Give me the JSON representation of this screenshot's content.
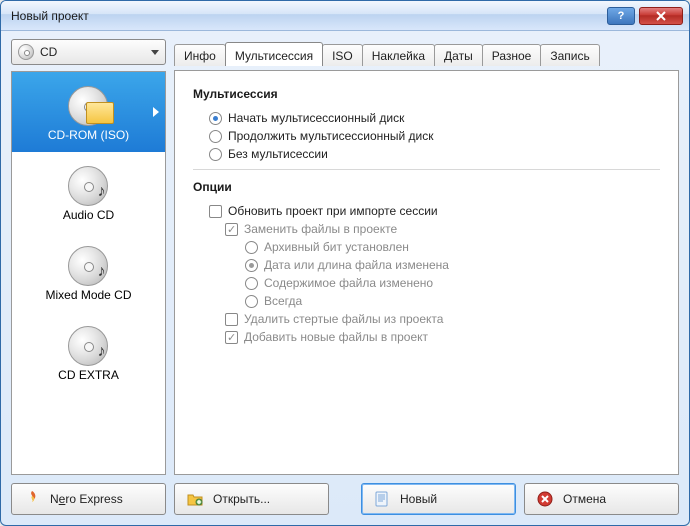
{
  "window": {
    "title": "Новый проект"
  },
  "combo": {
    "label": "CD"
  },
  "tabs": {
    "info": "Инфо",
    "multi": "Мультисессия",
    "iso": "ISO",
    "label": "Наклейка",
    "dates": "Даты",
    "misc": "Разное",
    "burn": "Запись"
  },
  "projects": {
    "cdrom": "CD-ROM (ISO)",
    "audio": "Audio CD",
    "mixed": "Mixed Mode CD",
    "extra": "CD EXTRA"
  },
  "section_multi": "Мультисессия",
  "section_options": "Опции",
  "multi": {
    "start": "Начать мультисессионный диск",
    "continue": "Продолжить мультисессионный диск",
    "none": "Без мультисессии"
  },
  "opts": {
    "refresh": "Обновить проект при импорте сессии",
    "replace": "Заменить файлы в проекте",
    "arch": "Архивный бит установлен",
    "date": "Дата или длина файла изменена",
    "content": "Содержимое файла изменено",
    "always": "Всегда",
    "del": "Удалить стертые файлы из проекта",
    "add": "Добавить новые файлы в проект"
  },
  "buttons": {
    "express_pre": "N",
    "express_u": "e",
    "express_post": "ro Express",
    "open": "Открыть...",
    "new": "Новый",
    "cancel": "Отмена"
  }
}
